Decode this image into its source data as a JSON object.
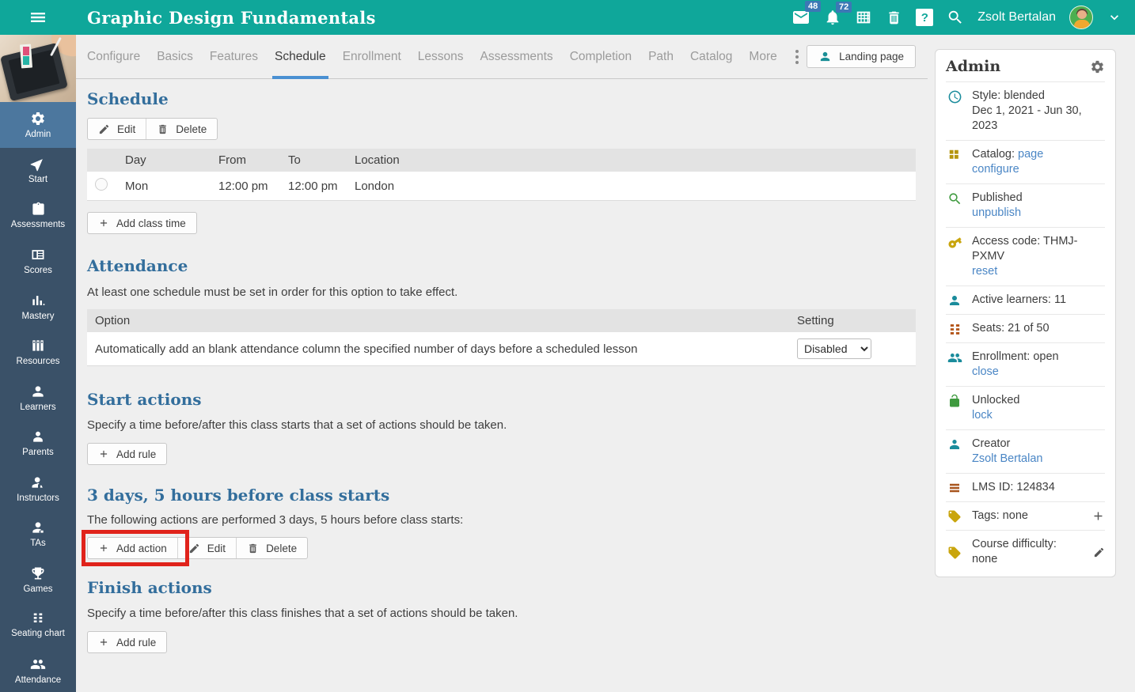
{
  "topbar": {
    "title": "Graphic Design Fundamentals",
    "messages_badge": "48",
    "notifications_badge": "72",
    "help_glyph": "?",
    "user_name": "Zsolt Bertalan"
  },
  "sidebar": {
    "items": [
      {
        "label": "Admin"
      },
      {
        "label": "Start"
      },
      {
        "label": "Assessments"
      },
      {
        "label": "Scores"
      },
      {
        "label": "Mastery"
      },
      {
        "label": "Resources"
      },
      {
        "label": "Learners"
      },
      {
        "label": "Parents"
      },
      {
        "label": "Instructors"
      },
      {
        "label": "TAs"
      },
      {
        "label": "Games"
      },
      {
        "label": "Seating chart"
      },
      {
        "label": "Attendance"
      }
    ]
  },
  "tabs": {
    "items": [
      {
        "label": "Configure"
      },
      {
        "label": "Basics"
      },
      {
        "label": "Features"
      },
      {
        "label": "Schedule"
      },
      {
        "label": "Enrollment"
      },
      {
        "label": "Lessons"
      },
      {
        "label": "Assessments"
      },
      {
        "label": "Completion"
      },
      {
        "label": "Path"
      },
      {
        "label": "Catalog"
      },
      {
        "label": "More"
      }
    ],
    "active": "Schedule",
    "landing_page_label": "Landing page"
  },
  "sections": {
    "schedule": {
      "heading": "Schedule",
      "edit_label": "Edit",
      "delete_label": "Delete",
      "table": {
        "headers": [
          "Day",
          "From",
          "To",
          "Location"
        ],
        "rows": [
          {
            "day": "Mon",
            "from": "12:00 pm",
            "to": "12:00 pm",
            "location": "London"
          }
        ]
      },
      "add_class_time_label": "Add class time"
    },
    "attendance": {
      "heading": "Attendance",
      "note": "At least one schedule must be set in order for this option to take effect.",
      "option_header": "Option",
      "setting_header": "Setting",
      "option_text": "Automatically add an blank attendance column the specified number of days before a scheduled lesson",
      "setting_value": "Disabled"
    },
    "start_actions": {
      "heading": "Start actions",
      "description": "Specify a time before/after this class starts that a set of actions should be taken.",
      "add_rule_label": "Add rule"
    },
    "rule_before_start": {
      "heading": "3 days, 5 hours before class starts",
      "description": "The following actions are performed 3 days, 5 hours before class starts:",
      "add_action_label": "Add action",
      "edit_label": "Edit",
      "delete_label": "Delete",
      "highlight_color": "#e0231b"
    },
    "finish_actions": {
      "heading": "Finish actions",
      "description": "Specify a time before/after this class finishes that a set of actions should be taken.",
      "add_rule_label": "Add rule"
    }
  },
  "admin_panel": {
    "title": "Admin",
    "rows": [
      {
        "title": "Style: blended",
        "sub": "Dec 1, 2021 - Jun 30, 2023"
      },
      {
        "title_prefix": "Catalog: ",
        "title_link": "page",
        "sub_link": "configure"
      },
      {
        "title": "Published",
        "sub_link": "unpublish"
      },
      {
        "title": "Access code: THMJ-PXMV",
        "sub_link": "reset"
      },
      {
        "title": "Active learners: 11"
      },
      {
        "title": "Seats: 21 of 50"
      },
      {
        "title": "Enrollment: open",
        "sub_link": "close"
      },
      {
        "title": "Unlocked",
        "sub_link": "lock"
      },
      {
        "title": "Creator",
        "sub_link": "Zsolt Bertalan"
      },
      {
        "title": "LMS ID: 124834"
      },
      {
        "title": "Tags: none"
      },
      {
        "title": "Course difficulty: none"
      }
    ]
  },
  "colors": {
    "topbar_teal": "#0fa79a",
    "sidebar_dark": "#3a5168",
    "sidebar_active": "#4c779e",
    "heading_blue": "#336e9c",
    "tab_underline": "#4a90d2",
    "link_blue": "#4a86c5",
    "badge_blue": "#3c78b5",
    "highlight_red": "#e0231b"
  }
}
